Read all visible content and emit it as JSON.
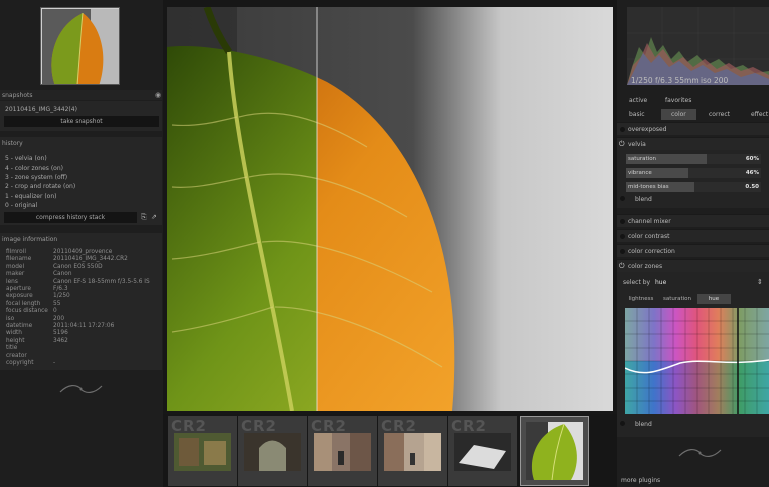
{
  "left": {
    "snapshots": {
      "title": "snapshots",
      "item": "20110416_IMG_3442(4)",
      "button": "take snapshot"
    },
    "history": {
      "title": "history",
      "items": [
        "5 - velvia (on)",
        "4 - color zones (on)",
        "3 - zone system (off)",
        "2 - crop and rotate (on)",
        "1 - equalizer (on)",
        "0 - original"
      ],
      "compress_button": "compress history stack"
    },
    "image_info": {
      "title": "image information",
      "rows": [
        {
          "label": "filmroll",
          "value": "20110409_provence"
        },
        {
          "label": "filename",
          "value": "20110416_IMG_3442.CR2"
        },
        {
          "label": "model",
          "value": "Canon EOS 550D"
        },
        {
          "label": "maker",
          "value": "Canon"
        },
        {
          "label": "lens",
          "value": "Canon EF-S 18-55mm f/3.5-5.6 IS"
        },
        {
          "label": "aperture",
          "value": "F/6.3"
        },
        {
          "label": "exposure",
          "value": "1/250"
        },
        {
          "label": "focal length",
          "value": "55"
        },
        {
          "label": "focus distance",
          "value": "0"
        },
        {
          "label": "iso",
          "value": "200"
        },
        {
          "label": "datetime",
          "value": "2011:04:11 17:27:06"
        },
        {
          "label": "width",
          "value": "5196"
        },
        {
          "label": "height",
          "value": "3462"
        },
        {
          "label": "title",
          "value": ""
        },
        {
          "label": "creator",
          "value": ""
        },
        {
          "label": "copyright",
          "value": "-"
        }
      ]
    }
  },
  "filmstrip": {
    "items": [
      {
        "label": "CR2",
        "scene": "street-1"
      },
      {
        "label": "CR2",
        "scene": "arch"
      },
      {
        "label": "CR2",
        "scene": "street-2"
      },
      {
        "label": "CR2",
        "scene": "street-3"
      },
      {
        "label": "CR2",
        "scene": "table"
      },
      {
        "label": "",
        "scene": "leaf",
        "selected": true
      }
    ]
  },
  "right": {
    "histogram_readout": "1/250 f/6.3 55mm iso 200",
    "groups": [
      "active",
      "favorites"
    ],
    "tabs": [
      "basic",
      "color",
      "correct",
      "effect"
    ],
    "active_tab": "color",
    "modules": {
      "overexposed": "overexposed",
      "velvia": "velvia",
      "channel_mixer": "channel mixer",
      "color_contrast": "color contrast",
      "color_correction": "color correction",
      "color_zones": "color zones"
    },
    "velvia_sliders": [
      {
        "label": "saturation",
        "value": "60",
        "unit": "%",
        "level": 0.6
      },
      {
        "label": "vibrance",
        "value": "46",
        "unit": "%",
        "level": 0.46
      },
      {
        "label": "mid-tones bias",
        "value": "0.50",
        "unit": "",
        "level": 0.5
      }
    ],
    "blend_label": "blend",
    "color_zones": {
      "select_by_label": "select by",
      "select_by_value": "hue",
      "tabs": [
        "lightness",
        "saturation",
        "hue"
      ],
      "active_tab": "hue",
      "blend_label": "blend"
    },
    "more_plugins": "more plugins"
  },
  "colors": {
    "leaf_green": "#7a9a1a",
    "leaf_orange": "#e07a10",
    "panel": "#262626",
    "background": "#1b1b1b"
  }
}
